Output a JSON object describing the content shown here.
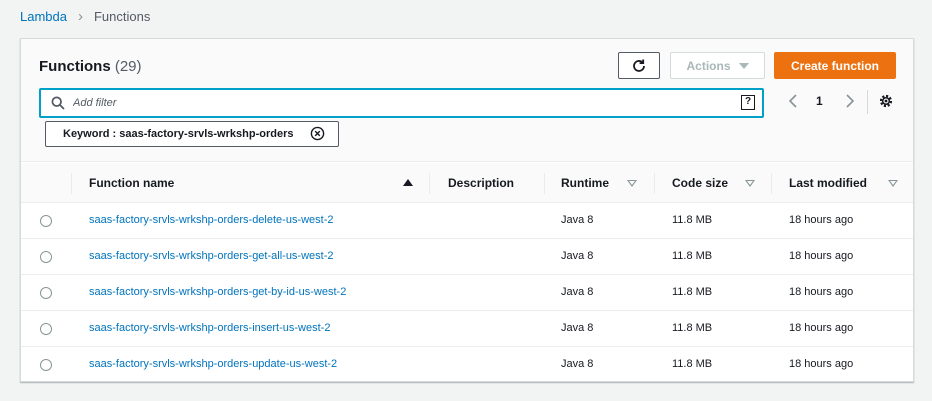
{
  "breadcrumb": {
    "parent": "Lambda",
    "current": "Functions"
  },
  "panel": {
    "title": "Functions",
    "count": "(29)",
    "actions_label": "Actions",
    "create_label": "Create function"
  },
  "search": {
    "placeholder": "Add filter",
    "value": ""
  },
  "pagination": {
    "page": "1"
  },
  "filter_token": {
    "label": "Keyword : saas-factory-srvls-wrkshp-orders"
  },
  "table": {
    "columns": {
      "name": "Function name",
      "description": "Description",
      "runtime": "Runtime",
      "code_size": "Code size",
      "last_modified": "Last modified"
    },
    "rows": [
      {
        "name": "saas-factory-srvls-wrkshp-orders-delete-us-west-2",
        "description": "",
        "runtime": "Java 8",
        "code_size": "11.8 MB",
        "last_modified": "18 hours ago"
      },
      {
        "name": "saas-factory-srvls-wrkshp-orders-get-all-us-west-2",
        "description": "",
        "runtime": "Java 8",
        "code_size": "11.8 MB",
        "last_modified": "18 hours ago"
      },
      {
        "name": "saas-factory-srvls-wrkshp-orders-get-by-id-us-west-2",
        "description": "",
        "runtime": "Java 8",
        "code_size": "11.8 MB",
        "last_modified": "18 hours ago"
      },
      {
        "name": "saas-factory-srvls-wrkshp-orders-insert-us-west-2",
        "description": "",
        "runtime": "Java 8",
        "code_size": "11.8 MB",
        "last_modified": "18 hours ago"
      },
      {
        "name": "saas-factory-srvls-wrkshp-orders-update-us-west-2",
        "description": "",
        "runtime": "Java 8",
        "code_size": "11.8 MB",
        "last_modified": "18 hours ago"
      }
    ]
  },
  "colors": {
    "primary_button": "#ec7211",
    "link": "#0073bb",
    "focus_border": "#00a1c9"
  },
  "icons": [
    "refresh-icon",
    "caret-down-icon",
    "search-icon",
    "help-icon",
    "chevron-left-icon",
    "chevron-right-icon",
    "settings-icon",
    "close-circle-icon",
    "sort-asc-icon",
    "sort-icon"
  ]
}
